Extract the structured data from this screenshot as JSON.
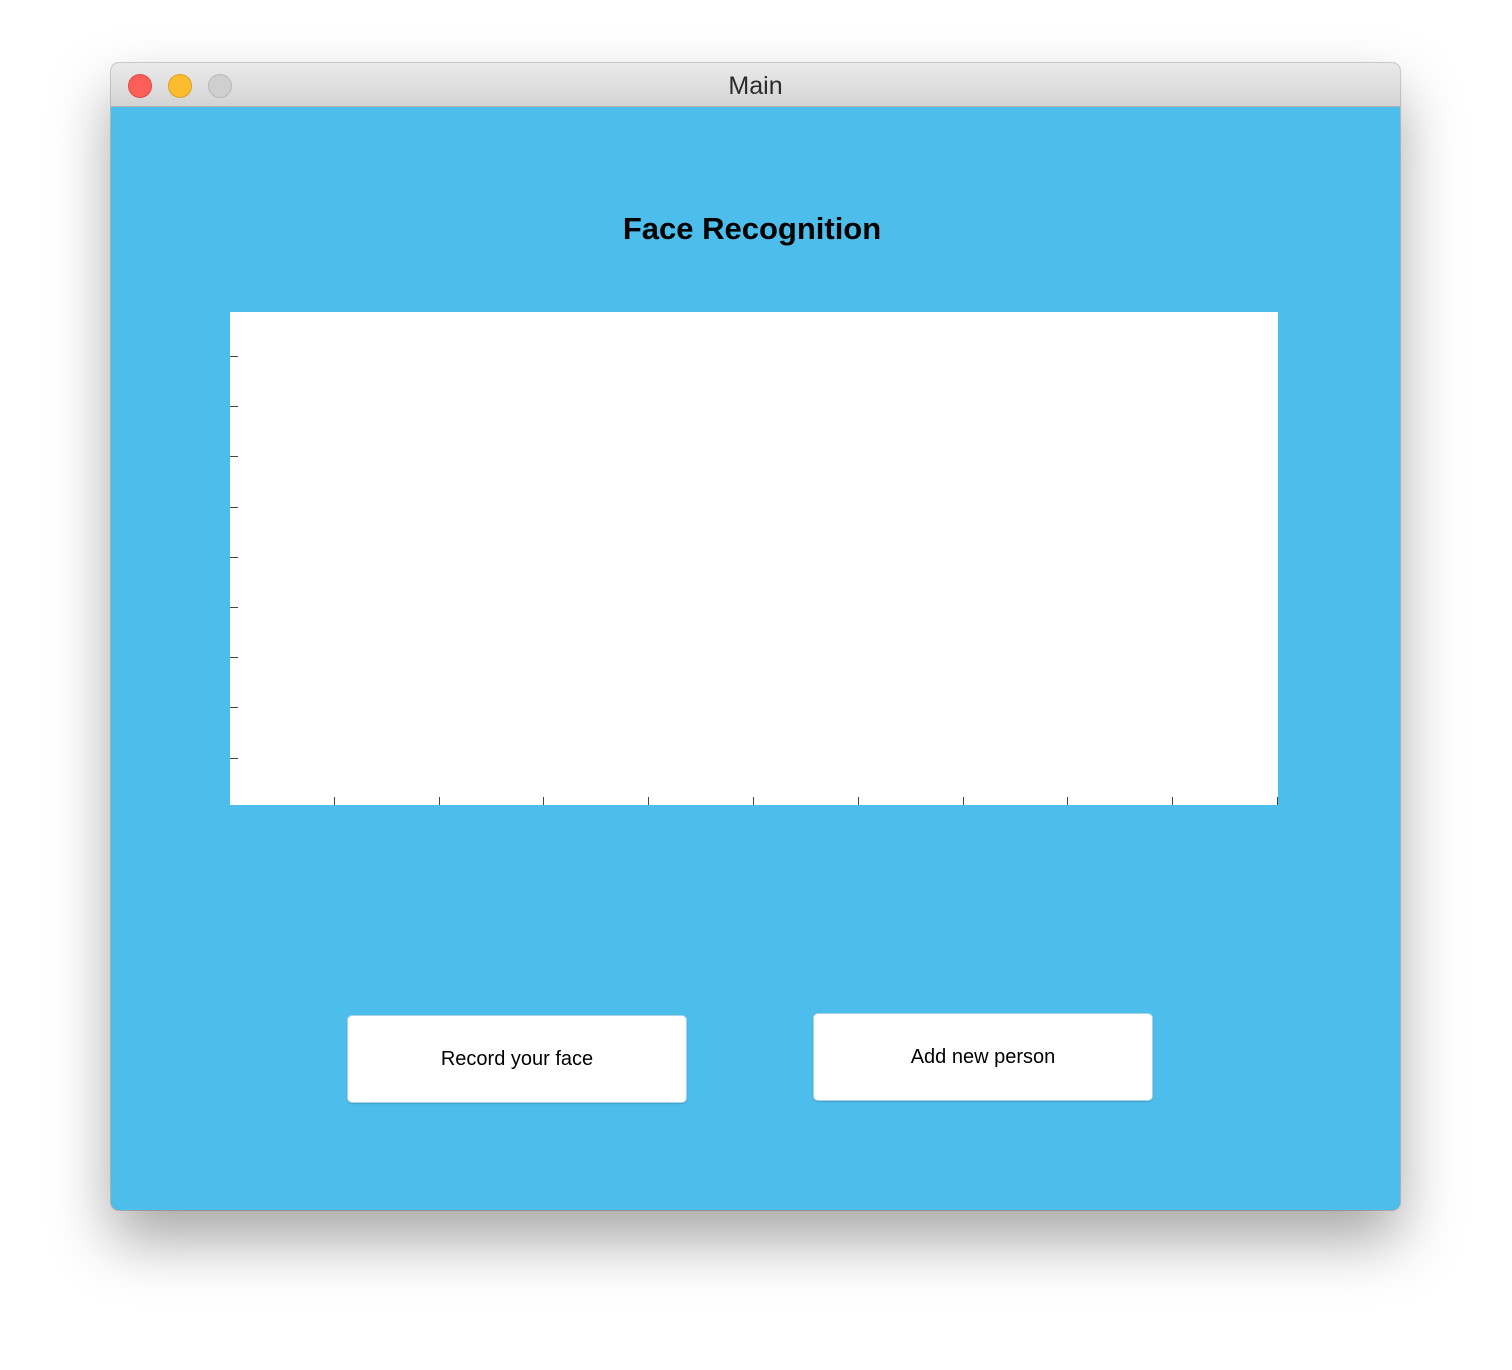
{
  "window": {
    "title": "Main"
  },
  "main": {
    "heading": "Face Recognition",
    "record_button_label": "Record your face",
    "add_person_button_label": "Add new person"
  },
  "plot": {
    "y_tick_count": 9,
    "x_tick_count": 10,
    "grid": false
  },
  "colors": {
    "background": "#4dbdeb",
    "plot_area": "#ffffff",
    "button": "#ffffff"
  }
}
